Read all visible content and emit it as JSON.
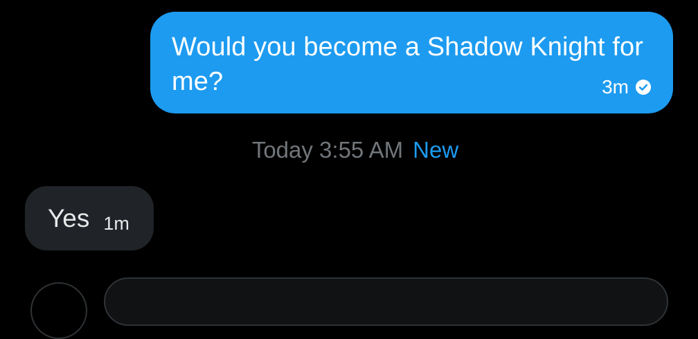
{
  "conversation": {
    "outgoing_message": {
      "text": "Would you become a Shadow Knight for me?",
      "time": "3m",
      "status_icon": "check-circle-icon"
    },
    "day_separator": {
      "label": "Today 3:55 AM",
      "new_label": "New"
    },
    "incoming_message": {
      "text": "Yes",
      "time": "1m"
    }
  },
  "colors": {
    "background": "#000000",
    "outgoing_bubble": "#1d9bf0",
    "incoming_bubble": "#202327",
    "accent": "#1d9bf0",
    "muted_text": "#71767b"
  }
}
